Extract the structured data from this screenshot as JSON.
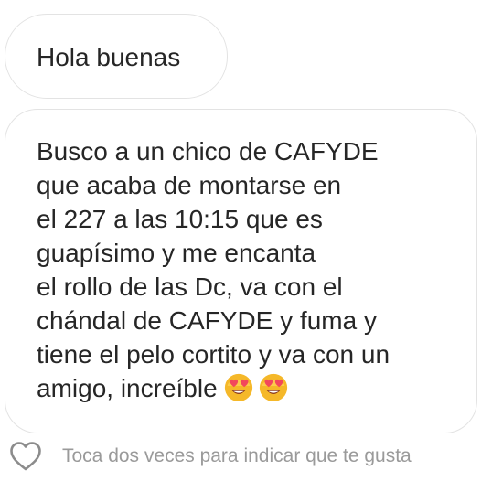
{
  "conversation": {
    "messages": [
      {
        "lines": [
          "Hola buenas"
        ]
      },
      {
        "lines": [
          "Busco a un chico de CAFYDE",
          "que acaba de montarse en",
          "el 227 a las 10:15 que es",
          "guapísimo y me encanta",
          "el rollo de las Dc, va con el",
          "chándal de CAFYDE y fuma y",
          "tiene el pelo cortito y va con un",
          "amigo, increíble"
        ],
        "emojis": [
          "heart-eyes-emoji",
          "heart-eyes-emoji"
        ]
      }
    ]
  },
  "footer": {
    "like_icon": "heart-outline-icon",
    "hint": "Toca dos veces para indicar que te gusta"
  },
  "colors": {
    "bubble_border": "#e3e3e3",
    "text": "#262626",
    "hint_text": "#9a9a9a",
    "emoji_face": "#f5b829",
    "emoji_hearts": "#f2485c"
  }
}
